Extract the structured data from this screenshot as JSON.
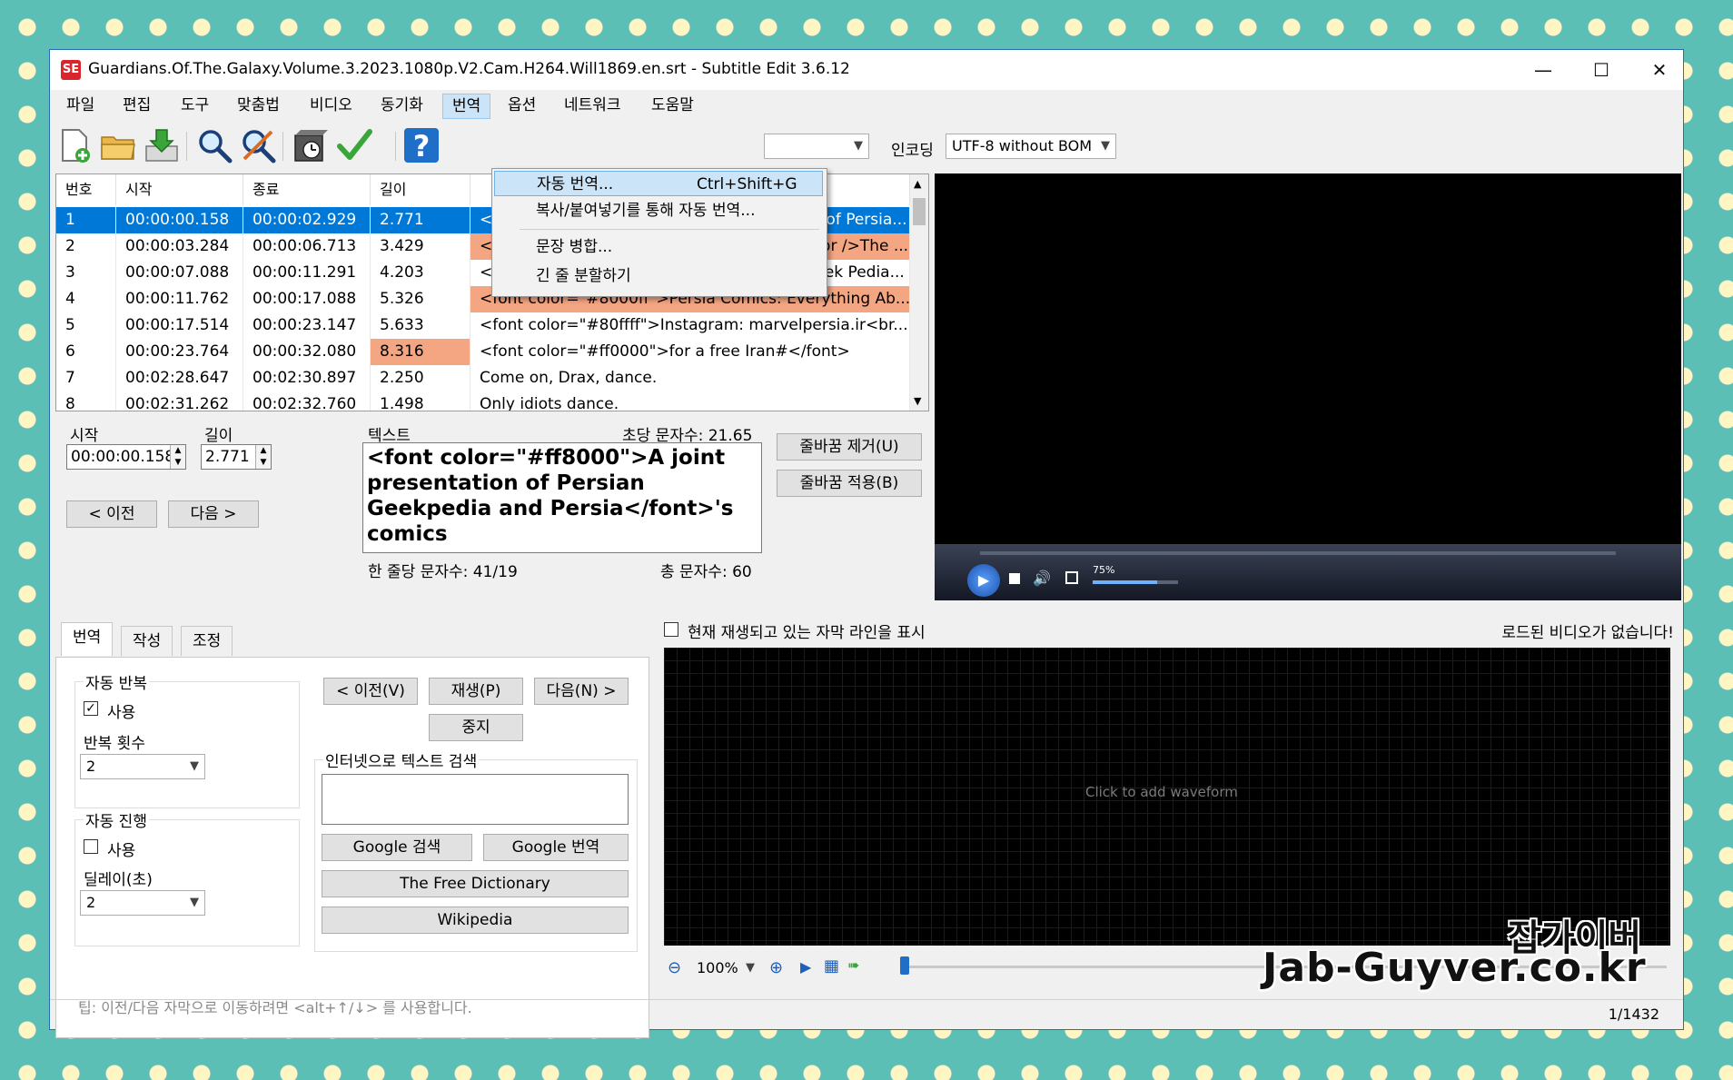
{
  "window": {
    "title": "Guardians.Of.The.Galaxy.Volume.3.2023.1080p.V2.Cam.H264.Will1869.en.srt - Subtitle Edit 3.6.12",
    "app_icon_text": "SE",
    "minimize": "—",
    "maximize": "☐",
    "close": "✕"
  },
  "menu": [
    "파일",
    "편집",
    "도구",
    "맞춤법",
    "비디오",
    "동기화",
    "번역",
    "옵션",
    "네트워크",
    "도움말"
  ],
  "toolbar": {
    "encoding_label": "인코딩",
    "encoding_value": "UTF-8 without BOM",
    "icons": [
      "new-file-icon",
      "open-folder-icon",
      "save-icon",
      "find-icon",
      "replace-icon",
      "visual-sync-icon",
      "spell-check-icon",
      "help-icon"
    ]
  },
  "translate_menu": {
    "items": [
      {
        "label": "자동 번역...",
        "shortcut": "Ctrl+Shift+G"
      },
      {
        "label": "복사/붙여넣기를 통해 자동 번역...",
        "shortcut": ""
      },
      {
        "label": "문장 병합...",
        "shortcut": ""
      },
      {
        "label": "긴 줄 분할하기",
        "shortcut": ""
      }
    ]
  },
  "grid": {
    "headers": [
      "번호",
      "시작",
      "종료",
      "길이",
      ""
    ],
    "rows": [
      {
        "num": "1",
        "start": "00:00:00.158",
        "end": "00:00:02.929",
        "dur": "2.771",
        "text": "<font color=\"#ff8000\">A joint presentation of Persia..."
      },
      {
        "num": "2",
        "start": "00:00:03.284",
        "end": "00:00:06.713",
        "dur": "3.429",
        "text": "<font color=\"#ffff00\">Persian Geek Pedia<br />The ..."
      },
      {
        "num": "3",
        "start": "00:00:07.088",
        "end": "00:00:11.291",
        "dur": "4.203",
        "text": "<font color=\"#0080ff\">YouTube: Persian Geek Pedia..."
      },
      {
        "num": "4",
        "start": "00:00:11.762",
        "end": "00:00:17.088",
        "dur": "5.326",
        "text": "<font color=\"#8000ff\">Persia Comics: Everything Ab..."
      },
      {
        "num": "5",
        "start": "00:00:17.514",
        "end": "00:00:23.147",
        "dur": "5.633",
        "text": "<font color=\"#80ffff\">Instagram: marvelpersia.ir<br..."
      },
      {
        "num": "6",
        "start": "00:00:23.764",
        "end": "00:00:32.080",
        "dur": "8.316",
        "text": "<font color=\"#ff0000\">for a free Iran#</font>"
      },
      {
        "num": "7",
        "start": "00:02:28.647",
        "end": "00:02:30.897",
        "dur": "2.250",
        "text": "Come on, Drax, dance."
      },
      {
        "num": "8",
        "start": "00:02:31.262",
        "end": "00:02:32.760",
        "dur": "1.498",
        "text": "Only idiots dance."
      }
    ]
  },
  "editor": {
    "start_label": "시작",
    "start_value": "00:00:00.158",
    "duration_label": "길이",
    "duration_value": "2.771",
    "text_label": "텍스트",
    "cps_label": "초당 문자수: 21.65",
    "text": "<font color=\"#ff8000\">A joint presentation of Persian Geekpedia and Persia</font>'s comics",
    "line_chars": "한 줄당 문자수: 41/19",
    "total_chars": "총 문자수: 60",
    "prev_button": "< 이전",
    "next_button": "다음 >",
    "remove_linebreak_button": "줄바꿈 제거(U)",
    "apply_linebreak_button": "줄바꿈 적용(B)"
  },
  "player": {
    "volume_percent": "75%",
    "volume_level": 0.75
  },
  "tabs": [
    "번역",
    "작성",
    "조정"
  ],
  "translate_tab": {
    "auto_repeat_title": "자동 반복",
    "auto_repeat_use": "사용",
    "repeat_count_label": "반복 횟수",
    "repeat_count_value": "2",
    "auto_continue_title": "자동 진행",
    "auto_continue_use": "사용",
    "delay_label": "딜레이(초)",
    "delay_value": "2",
    "prev_button": "< 이전(V)",
    "play_button": "재생(P)",
    "next_button": "다음(N) >",
    "stop_button": "중지",
    "search_group_title": "인터넷으로 텍스트 검색",
    "google_search_button": "Google 검색",
    "google_translate_button": "Google 번역",
    "free_dictionary_button": "The Free Dictionary",
    "wikipedia_button": "Wikipedia",
    "tip": "팁: 이전/다음 자막으로 이동하려면 <alt+↑/↓> 를 사용합니다."
  },
  "waveform": {
    "show_current_line_label": "현재 재생되고 있는 자막 라인을 표시",
    "no_video_text": "로드된 비디오가 없습니다!",
    "click_to_add": "Click to add waveform",
    "zoom_value": "100%"
  },
  "status": {
    "position": "1/1432"
  },
  "watermark": {
    "line1": "잡가이버",
    "line2": "Jab-Guyver.co.kr"
  },
  "colors": {
    "selected_row": "#0078d7",
    "warning_cell": "#f4a582",
    "menu_highlight": "#cce4f7",
    "background": "#5bbfb5",
    "dots": "#fff6c4"
  }
}
